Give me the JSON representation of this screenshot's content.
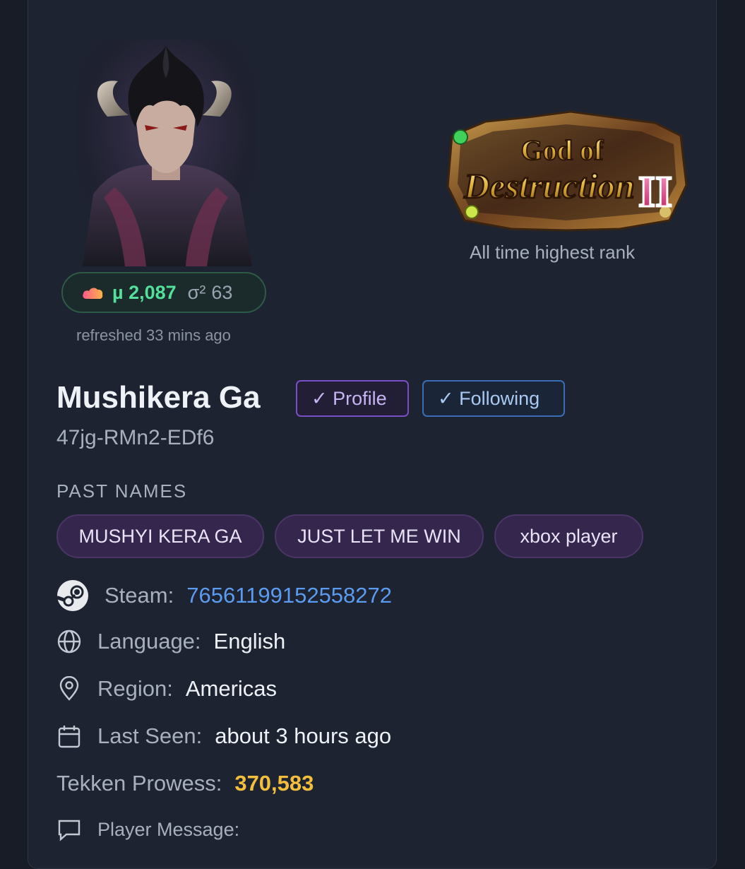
{
  "rating": {
    "mu_symbol": "µ",
    "mu_value": "2,087",
    "sigma_symbol": "σ²",
    "sigma_value": "63"
  },
  "refreshed": "refreshed 33 mins ago",
  "rank": {
    "line1": "God of",
    "line2": "Destruction",
    "numeral": "II",
    "caption": "All time highest rank"
  },
  "player": {
    "name": "Mushikera Ga",
    "id": "47jg-RMn2-EDf6",
    "badges": {
      "profile": "✓ Profile",
      "following": "✓ Following"
    }
  },
  "past_names": {
    "title": "PAST NAMES",
    "names": [
      "MUSHYI KERA GA",
      "JUST LET ME WIN",
      "xbox player"
    ]
  },
  "details": {
    "steam": {
      "label": "Steam:",
      "value": "76561199152558272",
      "icon": "steam-icon"
    },
    "language": {
      "label": "Language:",
      "value": "English",
      "icon": "globe-icon"
    },
    "region": {
      "label": "Region:",
      "value": "Americas",
      "icon": "map-pin-icon"
    },
    "last_seen": {
      "label": "Last Seen:",
      "value": "about 3 hours ago",
      "icon": "calendar-icon"
    },
    "prowess": {
      "label": "Tekken Prowess:",
      "value": "370,583"
    },
    "message": {
      "label": "Player Message:",
      "icon": "message-icon"
    }
  },
  "colors": {
    "mu": "#52e09a",
    "link": "#5b9cf0",
    "prowess": "#f3be3c",
    "profile_badge": "#7a4fc6",
    "following_badge": "#3a6db4",
    "chip_bg": "#34264d"
  }
}
